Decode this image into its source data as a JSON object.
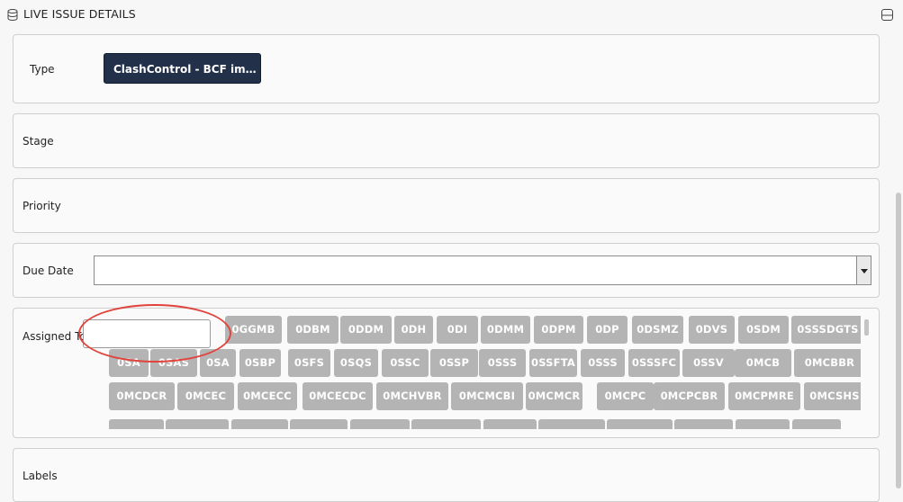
{
  "header": {
    "title": "LIVE ISSUE DETAILS",
    "left_icon": "database-icon",
    "right_icon": "panel-icon"
  },
  "fields": {
    "type": {
      "label": "Type",
      "value": "ClashControl - BCF imp..."
    },
    "stage": {
      "label": "Stage"
    },
    "priority": {
      "label": "Priority"
    },
    "due_date": {
      "label": "Due Date",
      "value": ""
    },
    "assigned_to": {
      "label": "Assigned To",
      "input_value": "",
      "tags": [
        "0GGMB",
        "0DBM",
        "0DDM",
        "0DH",
        "0DI",
        "0DMM",
        "0DPM",
        "0DP",
        "0DSMZ",
        "0DVS",
        "0SDM",
        "0SSSDGTS",
        "0SA",
        "0SAS",
        "0SA",
        "0SBP",
        "0SFS",
        "0SQS",
        "0SSC",
        "0SSP",
        "0SSS",
        "0SSFTA",
        "0SSS",
        "0SSSFC",
        "0SSV",
        "0MCB",
        "0MCBBR",
        "0MCDCR",
        "0MCEC",
        "0MCECC",
        "0MCECDC",
        "0MCHVBR",
        "0MCMCBI",
        "0MCMCR",
        "0MCPC",
        "0MCPCBR",
        "0MCPMRE",
        "0MCSHS"
      ]
    },
    "labels": {
      "label": "Labels"
    }
  },
  "colors": {
    "type_button_bg": "#22304a",
    "tag_bg": "#b4b4b4",
    "annotation": "#e0443c"
  }
}
